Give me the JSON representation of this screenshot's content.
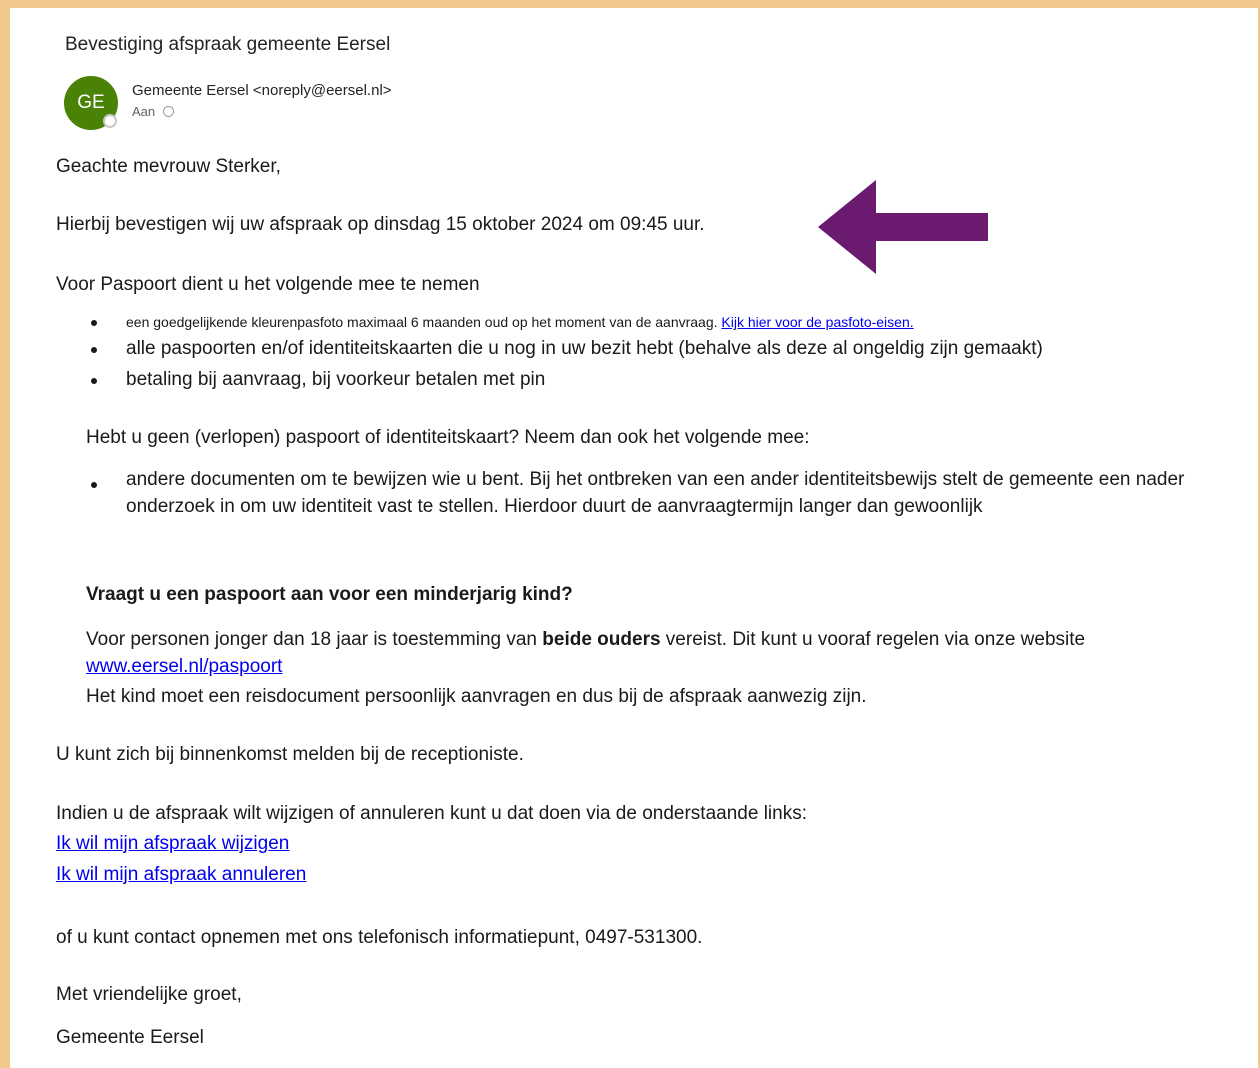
{
  "email": {
    "subject": "Bevestiging afspraak gemeente Eersel",
    "sender": {
      "initials": "GE",
      "display": "Gemeente Eersel <noreply@eersel.nl>",
      "to_label": "Aan",
      "avatar_color": "#498205"
    }
  },
  "body": {
    "greeting": "Geachte mevrouw Sterker,",
    "confirmation": "Hierbij bevestigen wij uw afspraak op dinsdag 15 oktober 2024 om 09:45 uur.",
    "intro": "Voor Paspoort dient u het volgende mee te nemen",
    "bullets": [
      {
        "text": "een goedgelijkende kleurenpasfoto maximaal 6 maanden oud op het moment van de aanvraag. ",
        "link": "Kijk hier voor de pasfoto-eisen."
      },
      {
        "text": "alle paspoorten en/of identiteitskaarten die u nog in uw bezit hebt (behalve als deze al ongeldig zijn gemaakt)"
      },
      {
        "text": "betaling bij aanvraag, bij voorkeur betalen met pin"
      }
    ],
    "no_passport_question": "Hebt u geen (verlopen) paspoort of identiteitskaart? Neem dan ook het volgende mee:",
    "no_passport_bullet": "andere documenten om te bewijzen wie u bent. Bij het ontbreken van een ander identiteitsbewijs stelt de gemeente een nader onderzoek in om uw identiteit vast te stellen. Hierdoor duurt de aanvraagtermijn langer dan gewoonlijk",
    "minor_heading": "Vraagt u een paspoort aan voor een minderjarig kind?",
    "minor_text_before": "Voor personen jonger dan 18 jaar is toestemming van ",
    "minor_text_bold": "beide ouders",
    "minor_text_after": " vereist. Dit kunt u vooraf regelen via onze website ",
    "minor_link": "www.eersel.nl/paspoort",
    "minor_child": "Het kind moet een reisdocument persoonlijk aanvragen en dus bij de afspraak aanwezig zijn.",
    "reception": "U kunt zich bij binnenkomst melden bij de receptioniste.",
    "change_intro": "Indien u de afspraak wilt wijzigen of annuleren kunt u dat doen via de onderstaande links:",
    "link_change": "Ik wil mijn afspraak wijzigen",
    "link_cancel": "Ik wil mijn afspraak annuleren",
    "contact": "of u kunt contact opnemen met ons telefonisch informatiepunt, 0497-531300.",
    "closing": "Met vriendelijke groet,",
    "signature": "Gemeente Eersel"
  },
  "annotation": {
    "arrow_color": "#6a1b70",
    "arrow_icon": "left-arrow-icon"
  },
  "colors": {
    "frame": "#f2c98d",
    "link": "#0000ee"
  }
}
